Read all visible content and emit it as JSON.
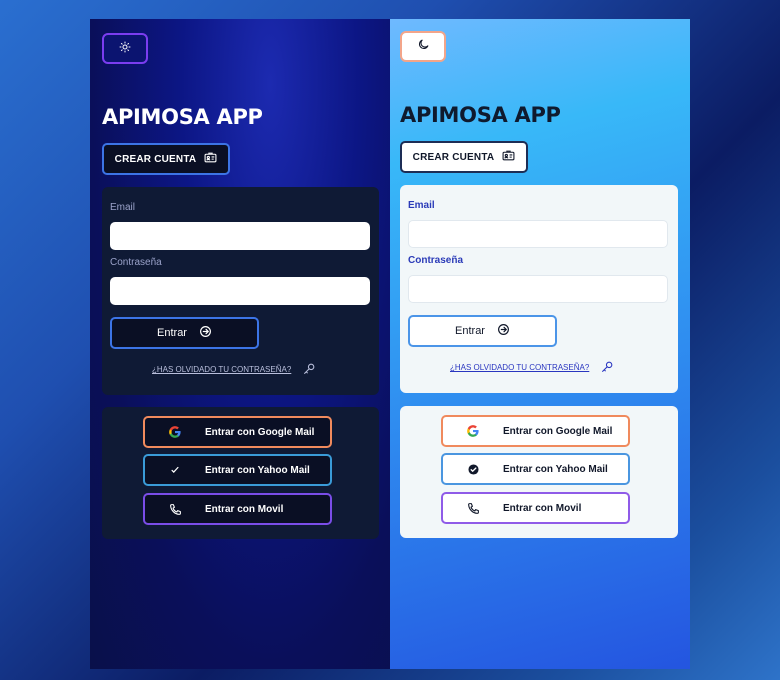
{
  "app_title": "APIMOSA APP",
  "create_account_label": "CREAR CUENTA",
  "email_label": "Email",
  "password_label": "Contraseña",
  "enter_label": "Entrar",
  "forgot_label": "¿HAS OLVIDADO TU CONTRASEÑA?",
  "social": {
    "google_label": "Entrar con Google Mail",
    "yahoo_label": "Entrar con Yahoo Mail",
    "phone_label": "Entrar con Movil"
  },
  "icons": {
    "dark_theme_toggle": "sun-icon",
    "light_theme_toggle": "moon-icon",
    "create_account": "id-card-icon",
    "enter": "arrow-right-circle-icon",
    "forgot": "key-icon",
    "google": "google-icon",
    "yahoo": "check-badge-icon",
    "phone": "phone-icon"
  },
  "colors": {
    "dark_bg": "#0a0f5a",
    "dark_card": "#0f1a35",
    "light_bg": "#2f8df0",
    "light_card": "#f2f7f9",
    "accent_blue": "#3c74e6",
    "google_border": "#f08a5d",
    "phone_border": "#8f5be8"
  }
}
